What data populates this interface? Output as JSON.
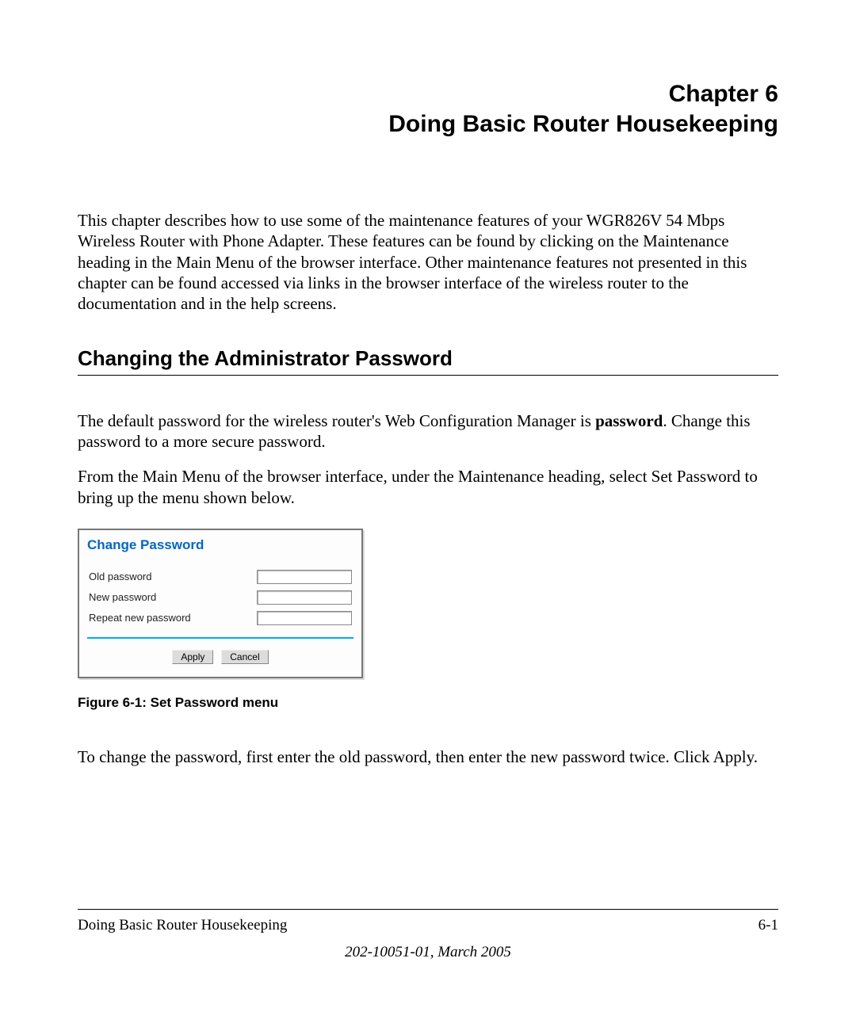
{
  "chapter": {
    "number_line": "Chapter 6",
    "title_line": "Doing Basic Router Housekeeping"
  },
  "intro": "This chapter describes how to use some of the maintenance features of your WGR826V 54 Mbps Wireless Router with Phone Adapter. These features can be found by clicking on the Maintenance heading in the Main Menu of the browser interface. Other maintenance features not presented in this chapter can be found accessed via links in the browser interface of the wireless router to the documentation and in the help screens.",
  "section": {
    "heading": "Changing the Administrator Password",
    "para1_pre": "The default password for the wireless router's Web Configuration Manager is ",
    "para1_bold": "password",
    "para1_post": ". Change this password to a more secure password.",
    "para2": "From the Main Menu of the browser interface, under the Maintenance heading, select Set Password to bring up the menu shown below."
  },
  "figure": {
    "panel_title": "Change Password",
    "labels": {
      "old": "Old password",
      "new": "New password",
      "repeat": "Repeat new password"
    },
    "buttons": {
      "apply": "Apply",
      "cancel": "Cancel"
    },
    "caption": "Figure 6-1:  Set Password menu"
  },
  "after_figure": "To change the password, first enter the old password, then enter the new password twice. Click Apply.",
  "footer": {
    "left": "Doing Basic Router Housekeeping",
    "right": "6-1",
    "docid": "202-10051-01, March 2005"
  }
}
